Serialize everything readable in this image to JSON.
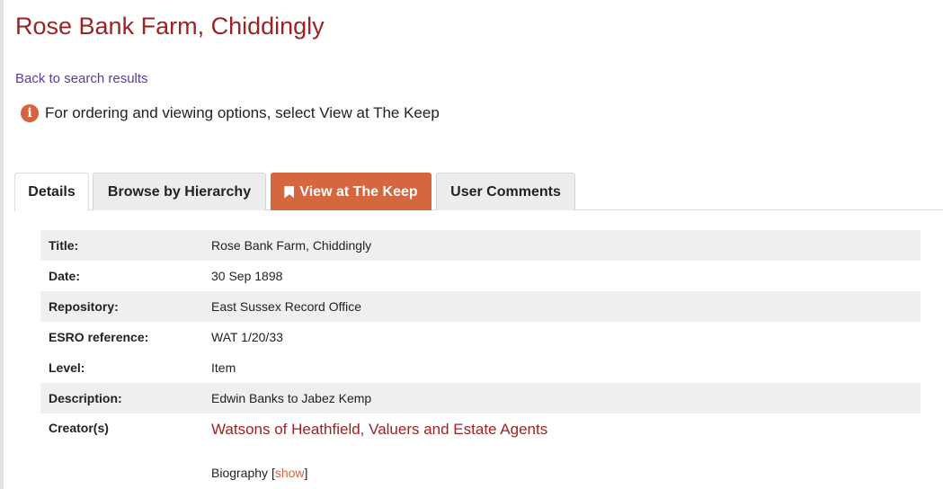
{
  "page": {
    "title": "Rose Bank Farm, Chiddingly",
    "back_link": "Back to search results",
    "notice": "For ordering and viewing options, select View at The Keep"
  },
  "tabs": [
    {
      "label": "Details",
      "active": true
    },
    {
      "label": "Browse by Hierarchy",
      "active": false
    },
    {
      "label": "View at The Keep",
      "active": false,
      "icon": "bookmark-icon"
    },
    {
      "label": "User Comments",
      "active": false
    }
  ],
  "details": [
    {
      "label": "Title:",
      "value": "Rose Bank Farm, Chiddingly"
    },
    {
      "label": "Date:",
      "value": "30 Sep 1898"
    },
    {
      "label": "Repository:",
      "value": "East Sussex Record Office"
    },
    {
      "label": "ESRO reference:",
      "value": "WAT 1/20/33"
    },
    {
      "label": "Level:",
      "value": "Item"
    },
    {
      "label": "Description:",
      "value": "Edwin Banks to Jabez Kemp"
    }
  ],
  "creator": {
    "label": "Creator(s)",
    "name": "Watsons of Heathfield, Valuers and Estate Agents",
    "biography_label": "Biography",
    "bracket_open": "[",
    "show_label": "show",
    "bracket_close": "]"
  },
  "colors": {
    "title": "#9b2323",
    "accent": "#d5673f",
    "link": "#5a3d99",
    "row_shade": "#efefef"
  }
}
